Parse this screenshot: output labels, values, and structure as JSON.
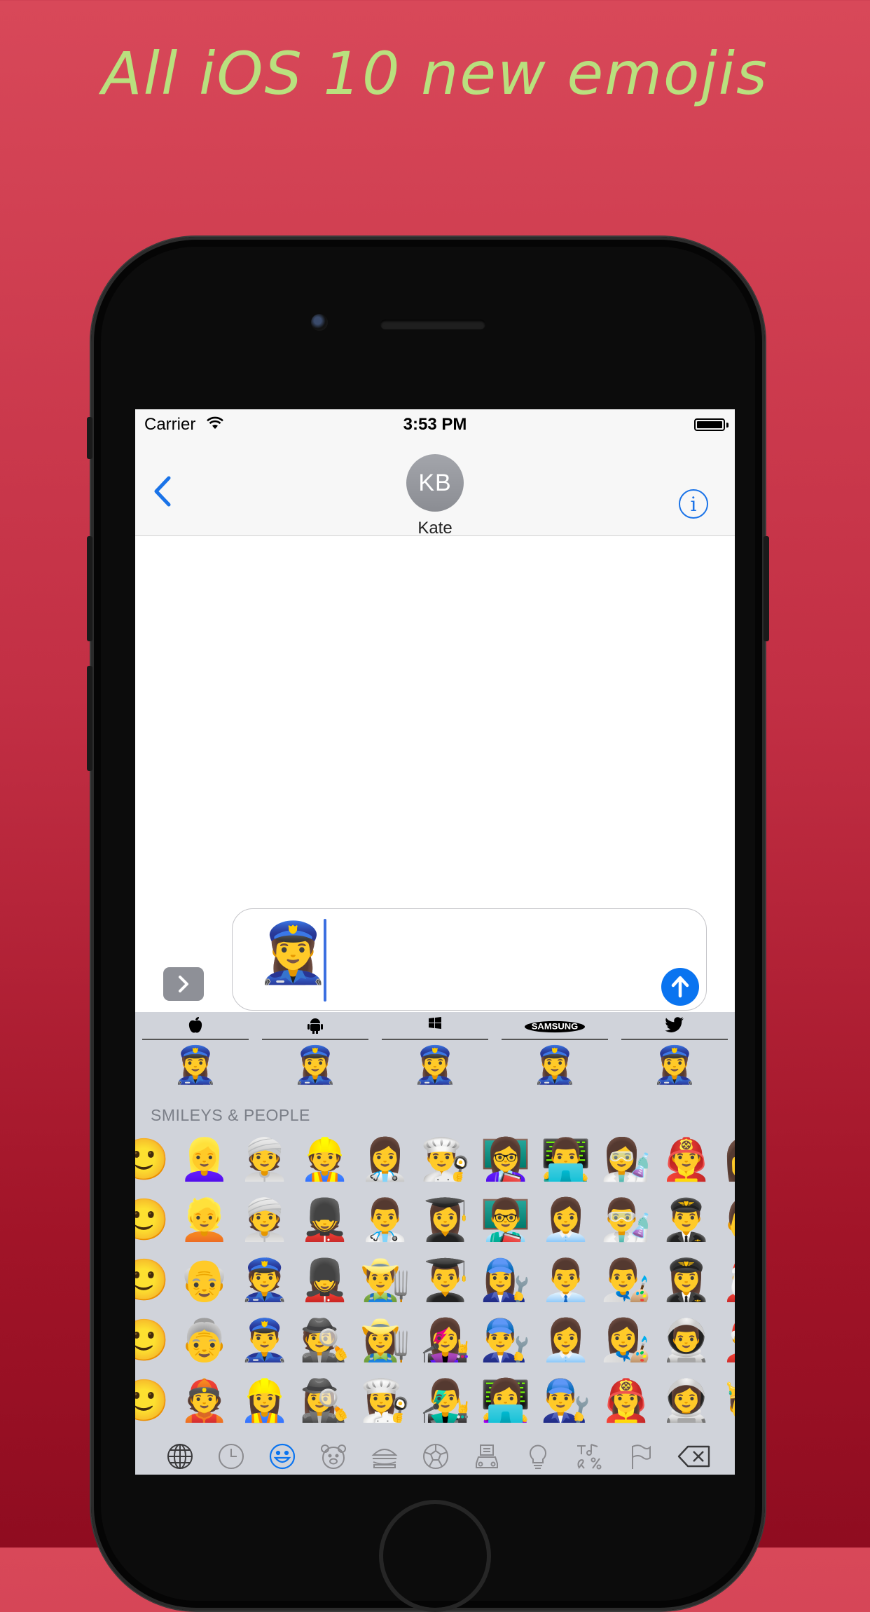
{
  "headline": "All iOS 10 new emojis",
  "status_bar": {
    "carrier": "Carrier",
    "time": "3:53 PM"
  },
  "nav": {
    "avatar_initials": "KB",
    "contact_name": "Kate",
    "info_glyph": "i"
  },
  "composer": {
    "draft_emoji": "👮‍♀️"
  },
  "platforms": [
    {
      "name": "apple",
      "logo": "",
      "emoji": "👮‍♀️"
    },
    {
      "name": "android",
      "logo": "",
      "emoji": "👮‍♀️"
    },
    {
      "name": "windows",
      "logo": "",
      "emoji": "👮‍♀️"
    },
    {
      "name": "samsung",
      "logo": "SAMSUNG",
      "emoji": "👮‍♀️"
    },
    {
      "name": "twitter",
      "logo": "",
      "emoji": "👮‍♀️"
    }
  ],
  "keyboard": {
    "section_label": "SMILEYS & PEOPLE",
    "rows": [
      [
        "🙂",
        "👱‍♀️",
        "👳",
        "👷",
        "👩‍⚕️",
        "👨‍🍳",
        "👩‍🏫",
        "👨‍💻",
        "👩‍🔬",
        "👨‍🚒",
        "👩"
      ],
      [
        "🙂",
        "👱",
        "👳",
        "💂",
        "👨‍⚕️",
        "👩‍🎓",
        "👨‍🏫",
        "👩‍💼",
        "👨‍🔬",
        "👨‍✈️",
        "👨"
      ],
      [
        "🙂",
        "👴",
        "👮",
        "💂‍♀️",
        "👨‍🌾",
        "👨‍🎓",
        "👩‍🔧",
        "👨‍💼",
        "👨‍🎨",
        "👩‍✈️",
        "🎅"
      ],
      [
        "🙂",
        "👵",
        "👮‍♂️",
        "🕵️",
        "👩‍🌾",
        "👩‍🎤",
        "👨‍🔧",
        "👩‍💼",
        "👩‍🎨",
        "👨‍🚀",
        "🤶"
      ],
      [
        "🙂",
        "👲",
        "👷‍♀️",
        "🕵️‍♀️",
        "👩‍🍳",
        "👨‍🎤",
        "👩‍💻",
        "👨‍🔧",
        "👩‍🚒",
        "👩‍🚀",
        "🤴"
      ]
    ],
    "category_icons": [
      "globe-icon",
      "clock-icon",
      "smiley-icon",
      "bear-icon",
      "food-icon",
      "ball-icon",
      "building-icon",
      "bulb-icon",
      "symbols-icon",
      "flag-icon",
      "delete-icon"
    ],
    "accent_color": "#0a74f0"
  }
}
